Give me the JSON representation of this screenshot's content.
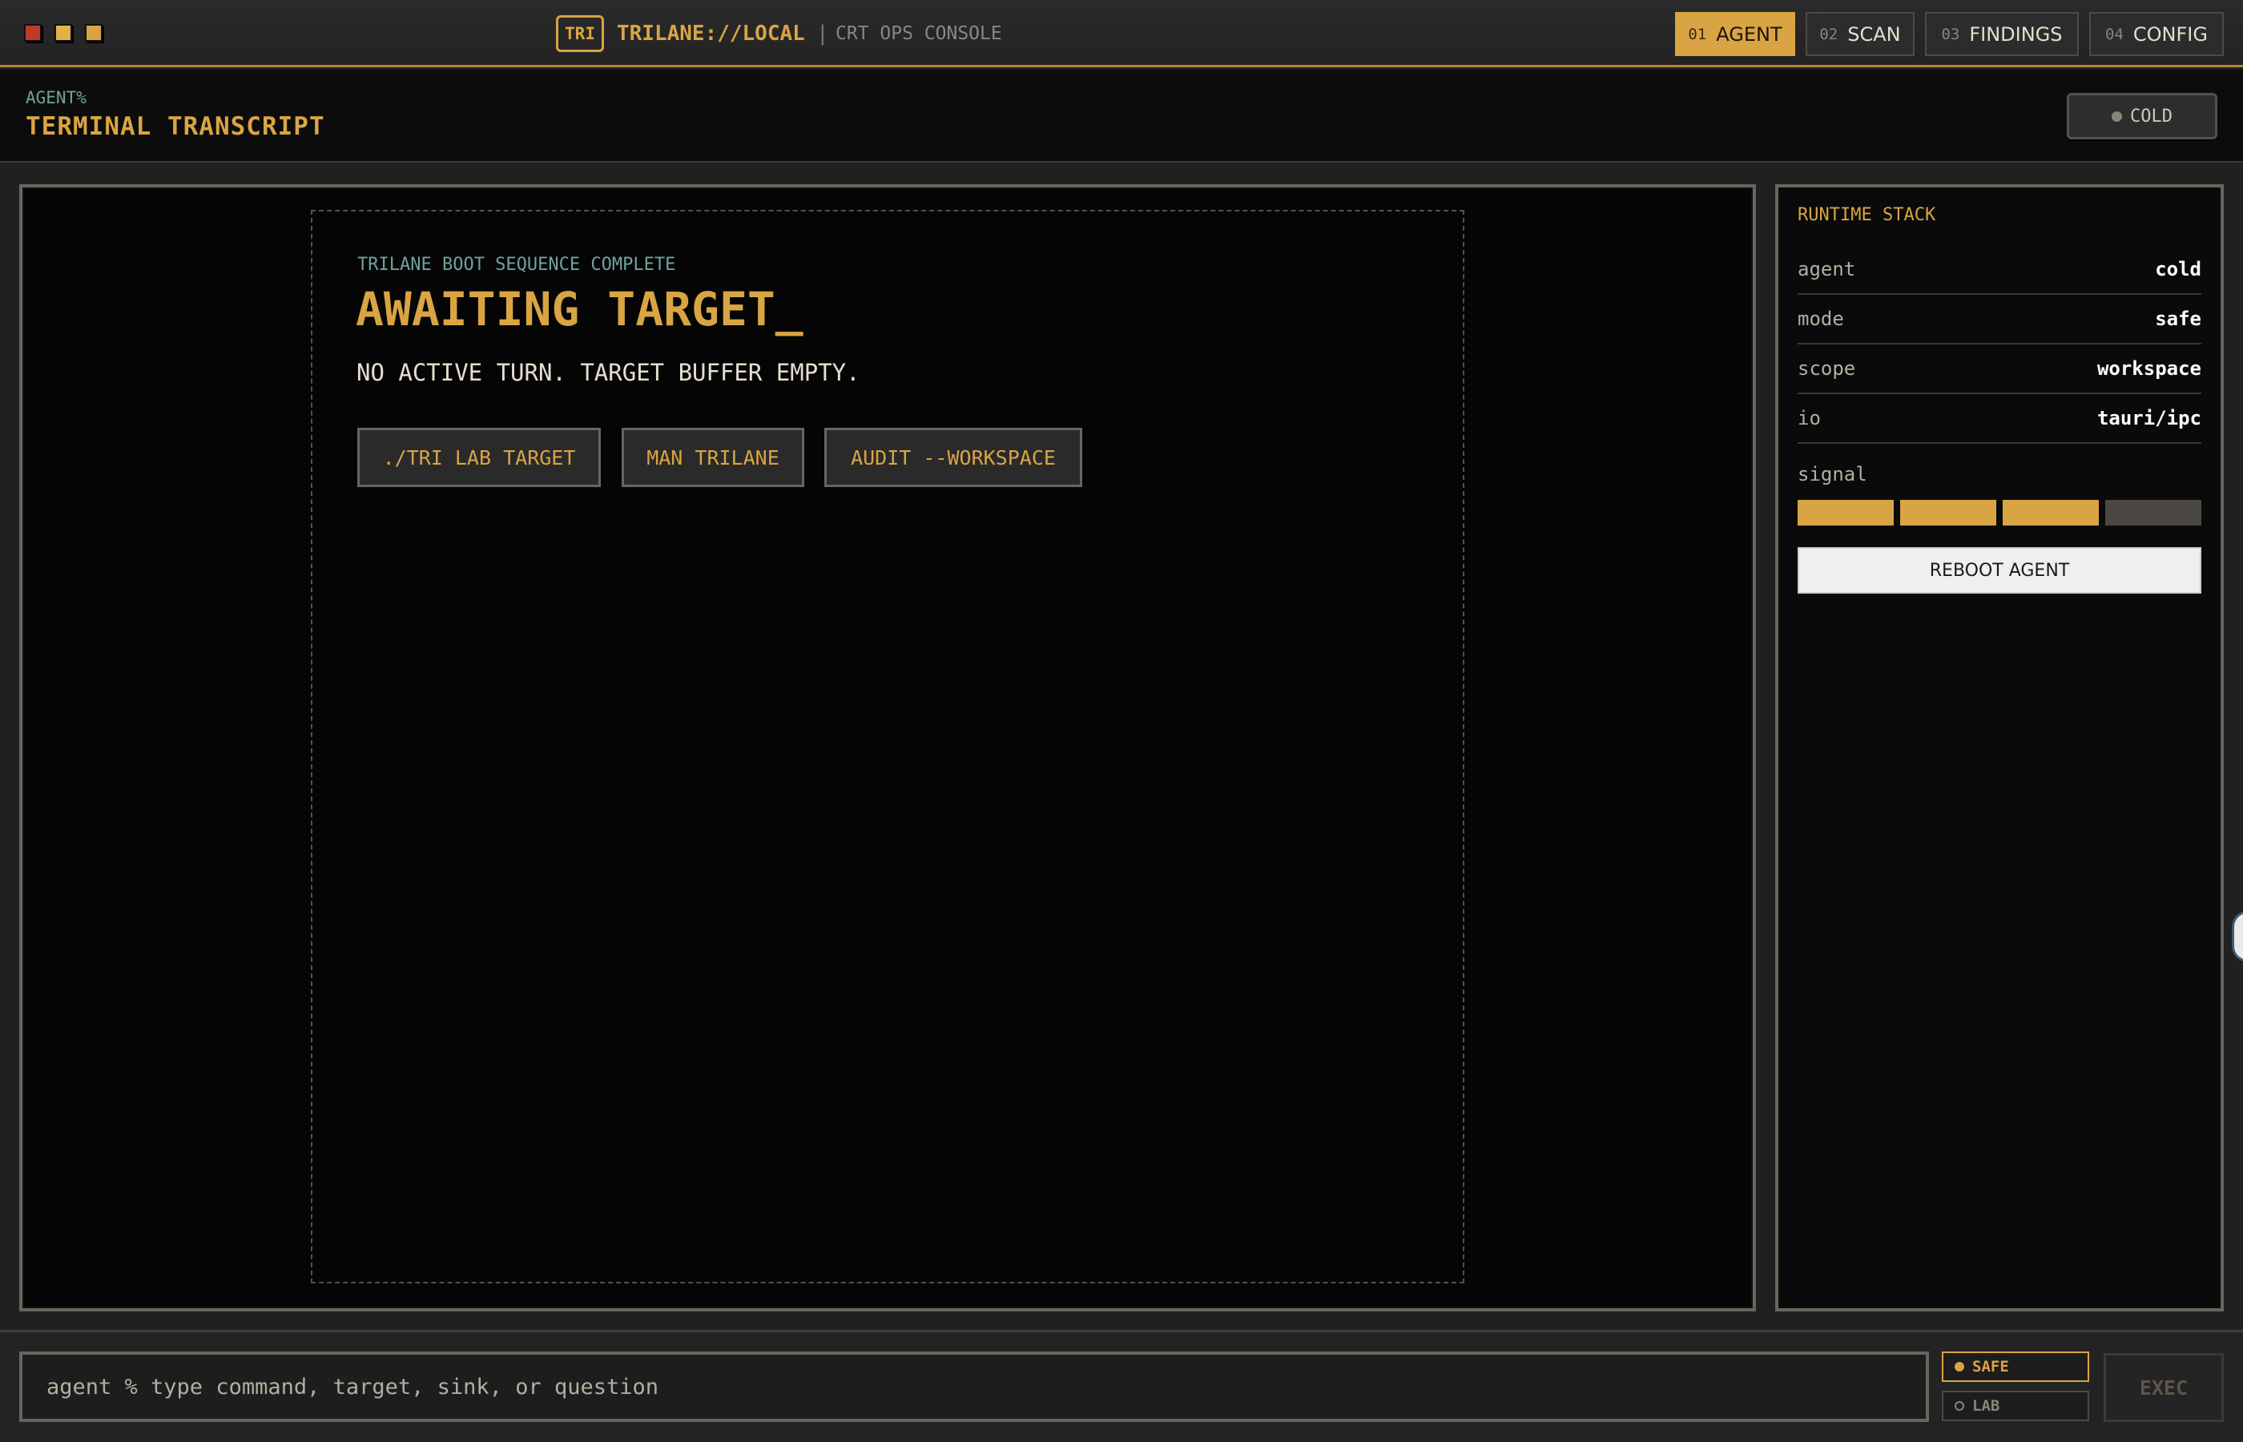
{
  "window": {
    "controls": [
      "close",
      "minimize",
      "maximize"
    ]
  },
  "brand": {
    "logo": "TRI",
    "name": "TRILANE://LOCAL",
    "separator": "|",
    "subtitle": "CRT OPS CONSOLE"
  },
  "nav": {
    "tabs": [
      {
        "num": "01",
        "label": "AGENT",
        "active": true
      },
      {
        "num": "02",
        "label": "SCAN",
        "active": false
      },
      {
        "num": "03",
        "label": "FINDINGS",
        "active": false
      },
      {
        "num": "04",
        "label": "CONFIG",
        "active": false
      }
    ]
  },
  "header": {
    "crumb": "AGENT%",
    "title": "TERMINAL TRANSCRIPT",
    "status": "COLD"
  },
  "boot": {
    "label": "TRILANE BOOT SEQUENCE COMPLETE",
    "title": "AWAITING TARGET_",
    "message": "NO ACTIVE TURN. TARGET BUFFER EMPTY.",
    "commands": [
      "./TRI LAB TARGET",
      "MAN TRILANE",
      "AUDIT --WORKSPACE"
    ]
  },
  "runtime": {
    "title": "RUNTIME STACK",
    "rows": [
      {
        "key": "agent",
        "value": "cold"
      },
      {
        "key": "mode",
        "value": "safe"
      },
      {
        "key": "scope",
        "value": "workspace"
      },
      {
        "key": "io",
        "value": "tauri/ipc"
      }
    ],
    "signal_label": "signal",
    "signal_level": 3,
    "signal_max": 4,
    "reboot_label": "REBOOT AGENT"
  },
  "command_bar": {
    "placeholder": "agent % type command, target, sink, or question",
    "modes": [
      {
        "label": "SAFE",
        "active": true
      },
      {
        "label": "LAB",
        "active": false
      }
    ],
    "exec_label": "EXEC"
  },
  "colors": {
    "accent": "#d9a443",
    "teal": "#6ea39c",
    "close": "#c0392b"
  },
  "icons": [
    "window-close-icon",
    "window-minimize-icon",
    "window-maximize-icon",
    "status-dot-icon",
    "mode-dot-icon"
  ]
}
